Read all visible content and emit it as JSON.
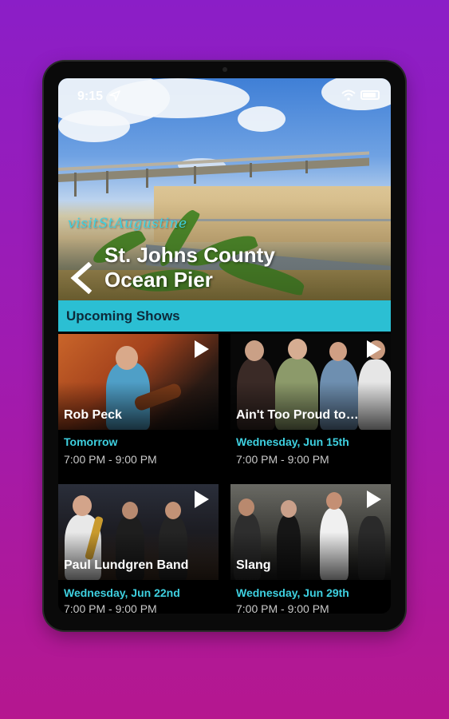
{
  "status_bar": {
    "time": "9:15"
  },
  "venue": {
    "brand": "visitStAugustine",
    "title_line1": "St. Johns County",
    "title_line2": "Ocean Pier"
  },
  "section": {
    "title": "Upcoming Shows"
  },
  "shows": [
    {
      "name": "Rob Peck",
      "date": "Tomorrow",
      "time": "7:00 PM - 9:00 PM"
    },
    {
      "name": "Ain't Too Proud to…",
      "date": "Wednesday, Jun 15th",
      "time": "7:00 PM - 9:00 PM"
    },
    {
      "name": "Paul Lundgren Band",
      "date": "Wednesday, Jun 22nd",
      "time": "7:00 PM - 9:00 PM"
    },
    {
      "name": "Slang",
      "date": "Wednesday, Jun 29th",
      "time": "7:00 PM - 9:00 PM"
    }
  ],
  "colors": {
    "accent": "#2bbfd3",
    "date_text": "#3ed0e0",
    "background_top": "#8b1ec7",
    "background_bottom": "#b5178f"
  },
  "icons": [
    "location-icon",
    "wifi-icon",
    "battery-icon",
    "back-icon",
    "play-icon"
  ]
}
